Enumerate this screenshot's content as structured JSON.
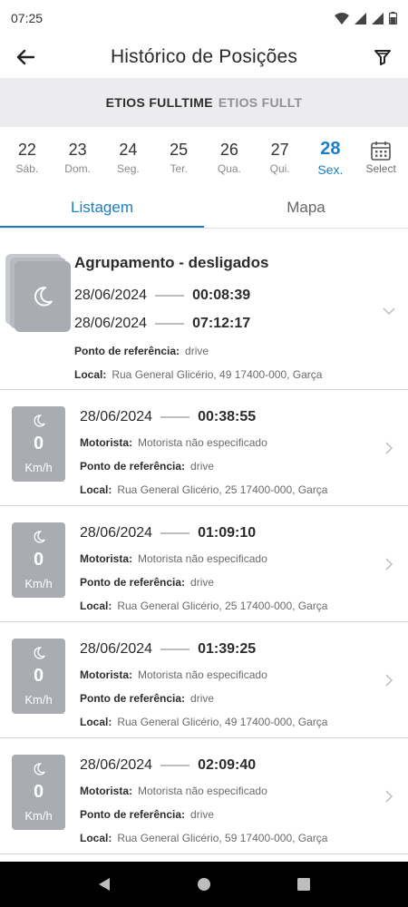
{
  "status": {
    "time": "07:25",
    "icons": [
      "wifi-icon",
      "signal-icon",
      "signal-icon",
      "battery-icon"
    ]
  },
  "header": {
    "title": "Histórico de Posições",
    "back_icon": "arrow-left-icon",
    "filter_icon": "filter-icon"
  },
  "vehicles": {
    "selected": "ETIOS FULLTIME",
    "next": "ETIOS FULLT"
  },
  "days": [
    {
      "num": "22",
      "wd": "Sáb."
    },
    {
      "num": "23",
      "wd": "Dom."
    },
    {
      "num": "24",
      "wd": "Seg."
    },
    {
      "num": "25",
      "wd": "Ter."
    },
    {
      "num": "26",
      "wd": "Qua."
    },
    {
      "num": "27",
      "wd": "Qui."
    },
    {
      "num": "28",
      "wd": "Sex."
    }
  ],
  "select_label": "Select",
  "tabs": {
    "list": "Listagem",
    "map": "Mapa"
  },
  "labels": {
    "ref": "Ponto de referência:",
    "local": "Local:",
    "driver": "Motorista:",
    "unit": "Km/h"
  },
  "group": {
    "title": "Agrupamento - desligados",
    "start_date": "28/06/2024",
    "start_time": "00:08:39",
    "end_date": "28/06/2024",
    "end_time": "07:12:17",
    "ref": "drive",
    "local": "Rua General Glicério, 49 17400-000, Garça"
  },
  "items": [
    {
      "date": "28/06/2024",
      "time": "00:38:55",
      "speed": "0",
      "driver": "Motorista não especificado",
      "ref": "drive",
      "local": "Rua General Glicério, 25 17400-000, Garça"
    },
    {
      "date": "28/06/2024",
      "time": "01:09:10",
      "speed": "0",
      "driver": "Motorista não especificado",
      "ref": "drive",
      "local": "Rua General Glicério, 25 17400-000, Garça"
    },
    {
      "date": "28/06/2024",
      "time": "01:39:25",
      "speed": "0",
      "driver": "Motorista não especificado",
      "ref": "drive",
      "local": "Rua General Glicério, 49 17400-000, Garça"
    },
    {
      "date": "28/06/2024",
      "time": "02:09:40",
      "speed": "0",
      "driver": "Motorista não especificado",
      "ref": "drive",
      "local": "Rua General Glicério, 59 17400-000, Garça"
    }
  ],
  "colors": {
    "accent": "#1b7ec4",
    "tile": "#a9adb2",
    "vehicle_bar": "#ececef"
  }
}
